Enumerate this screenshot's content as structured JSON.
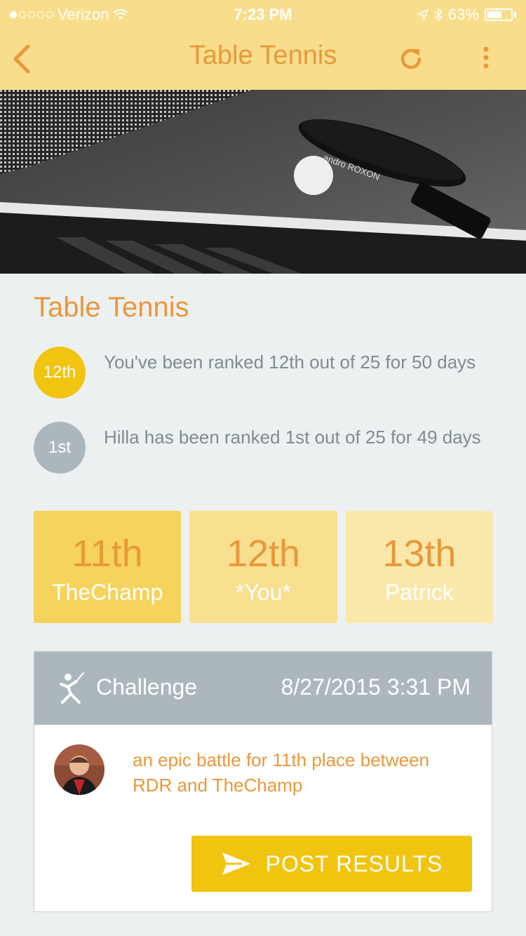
{
  "status_bar": {
    "carrier": "Verizon",
    "time": "7:23 PM",
    "battery": "63%",
    "battery_level": 0.63,
    "signal_bars": 1
  },
  "nav": {
    "title": "Table Tennis",
    "back_icon": "chevron-left-icon",
    "refresh_icon": "refresh-icon",
    "more_icon": "more-vertical-icon"
  },
  "hero": {
    "image": "table-tennis-paddle-photo"
  },
  "section": {
    "title": "Table Tennis"
  },
  "rankings": [
    {
      "badge": "12th",
      "text": "You've been ranked 12th out of 25 for 50 days",
      "color": "#f1c40f"
    },
    {
      "badge": "1st",
      "text": "Hilla has been ranked 1st out of 25 for 49 days",
      "color": "#acb7bd"
    }
  ],
  "leaderboard": [
    {
      "rank": "11th",
      "name": "TheChamp",
      "color": "#f5d35c"
    },
    {
      "rank": "12th",
      "name": "*You*",
      "color": "#f8df8f"
    },
    {
      "rank": "13th",
      "name": "Patrick",
      "color": "#fae8ab"
    }
  ],
  "challenge": {
    "label": "Challenge",
    "date": "8/27/2015 3:31 PM",
    "description": "an epic battle for 11th place between RDR and TheChamp",
    "button_label": "POST RESULTS",
    "button_icon": "send-icon"
  },
  "colors": {
    "accent": "#e8983a",
    "header_yellow": "#f8de8c",
    "button_yellow": "#f1c40f",
    "gray": "#acb7bd"
  }
}
